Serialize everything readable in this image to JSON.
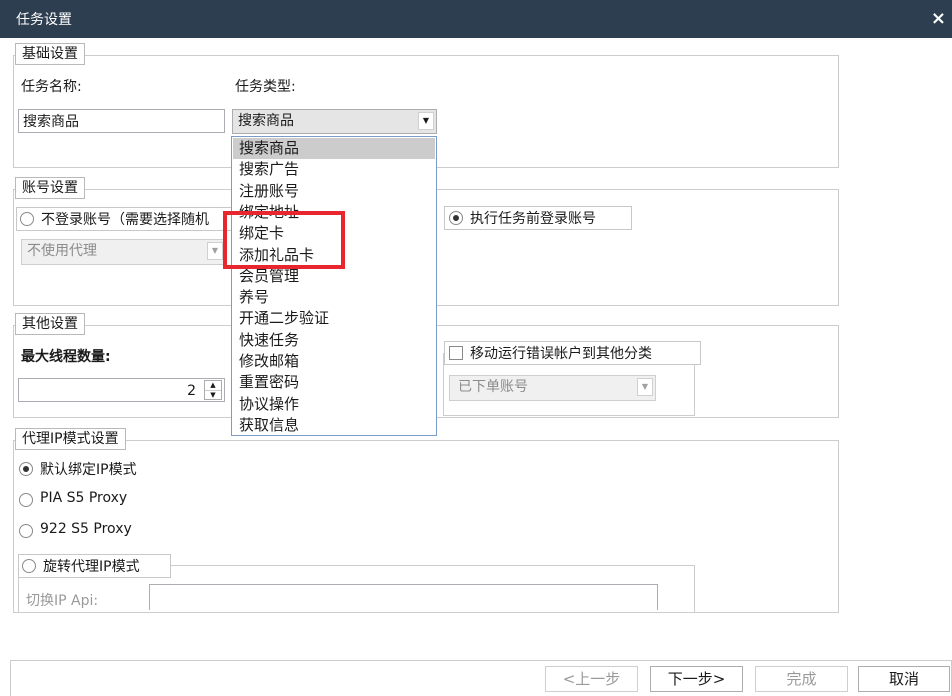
{
  "window": {
    "title": "任务设置",
    "close_glyph": "×"
  },
  "basic": {
    "legend": "基础设置",
    "task_name_label": "任务名称:",
    "task_name_value": "搜索商品",
    "task_type_label": "任务类型:",
    "task_type_value": "搜索商品",
    "task_type_options": [
      "搜索商品",
      "搜索广告",
      "注册账号",
      "绑定地址",
      "绑定卡",
      "添加礼品卡",
      "会员管理",
      "养号",
      "开通二步验证",
      "快速任务",
      "修改邮箱",
      "重置密码",
      "协议操作",
      "获取信息"
    ]
  },
  "account": {
    "legend": "账号设置",
    "no_login_label": "不登录账号（需要选择随机",
    "proxy_select_value": "不使用代理",
    "login_before_label": "执行任务前登录账号"
  },
  "other": {
    "legend": "其他设置",
    "max_threads_label": "最大线程数量:",
    "max_threads_value": "2",
    "move_error_label": "移动运行错误帐户到其他分类",
    "category_value": "已下单账号"
  },
  "proxy": {
    "legend": "代理IP模式设置",
    "option_default": "默认绑定IP模式",
    "option_pia": "PIA S5 Proxy",
    "option_922": "922 S5 Proxy",
    "rotate_legend": "旋转代理IP模式",
    "switch_api_label": "切换IP Api:",
    "switch_api_value": ""
  },
  "footer": {
    "prev": "<上一步",
    "next": "下一步>",
    "finish": "完成",
    "cancel": "取消"
  },
  "colors": {
    "titlebar": "#2d3e50",
    "highlight": "#e8262d",
    "selected_item": "#cccccc"
  }
}
